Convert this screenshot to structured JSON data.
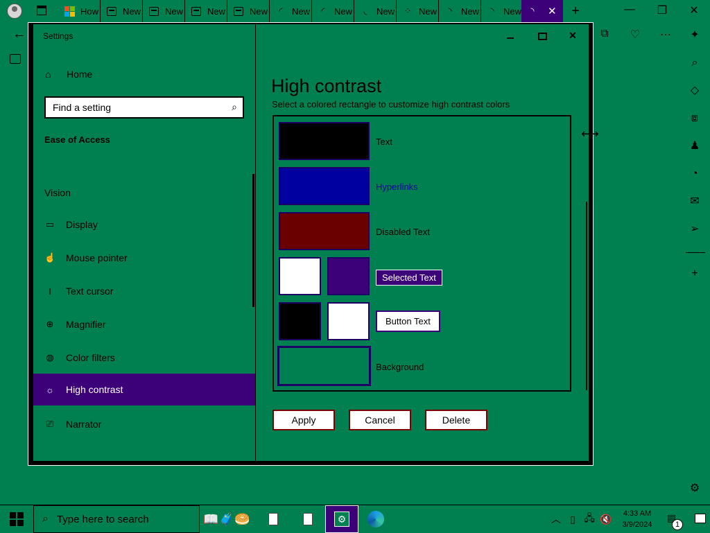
{
  "browser": {
    "tabs": [
      {
        "label": "How",
        "icon": "microsoft-logo"
      },
      {
        "label": "New",
        "icon": "document-icon"
      },
      {
        "label": "New",
        "icon": "document-icon"
      },
      {
        "label": "New",
        "icon": "document-icon"
      },
      {
        "label": "New",
        "icon": "document-icon"
      },
      {
        "label": "New",
        "icon": "loading-icon"
      },
      {
        "label": "New",
        "icon": "loading-icon"
      },
      {
        "label": "New",
        "icon": "loading-icon"
      },
      {
        "label": "New",
        "icon": "loading-icon"
      },
      {
        "label": "New",
        "icon": "loading-icon"
      },
      {
        "label": "New",
        "icon": "loading-icon"
      }
    ],
    "active_tab_close": "✕"
  },
  "settings": {
    "window_title": "Settings",
    "nav": {
      "home_label": "Home",
      "search_placeholder": "Find a setting",
      "section": "Ease of Access",
      "group": "Vision",
      "items": [
        {
          "label": "Display",
          "icon": "monitor-icon"
        },
        {
          "label": "Mouse pointer",
          "icon": "mouse-pointer-icon"
        },
        {
          "label": "Text cursor",
          "icon": "text-cursor-icon"
        },
        {
          "label": "Magnifier",
          "icon": "magnifier-icon"
        },
        {
          "label": "Color filters",
          "icon": "color-filters-icon"
        },
        {
          "label": "High contrast",
          "icon": "sun-icon",
          "selected": true
        },
        {
          "label": "Narrator",
          "icon": "narrator-icon"
        }
      ]
    },
    "content": {
      "title": "High contrast",
      "subtitle": "Select a colored rectangle to customize high contrast colors",
      "rows": {
        "text": {
          "label": "Text",
          "color": "#000000"
        },
        "hyperlinks": {
          "label": "Hyperlinks",
          "color": "#0000a0"
        },
        "disabled": {
          "label": "Disabled Text",
          "color": "#6b0000"
        },
        "selected": {
          "label": "Selected Text",
          "fg": "#ffffff",
          "bg": "#3c0078"
        },
        "button": {
          "label": "Button Text",
          "fg": "#000000",
          "bg": "#ffffff"
        },
        "background": {
          "label": "Background",
          "color": "#008050"
        }
      },
      "buttons": {
        "apply": "Apply",
        "cancel": "Cancel",
        "delete": "Delete"
      }
    }
  },
  "taskbar": {
    "search_placeholder": "Type here to search",
    "time": "4:33 AM",
    "date": "3/9/2024",
    "notification_count": "1"
  },
  "colors": {
    "desktop_bg": "#008050",
    "accent": "#3c0078",
    "window_border": "#000000"
  }
}
